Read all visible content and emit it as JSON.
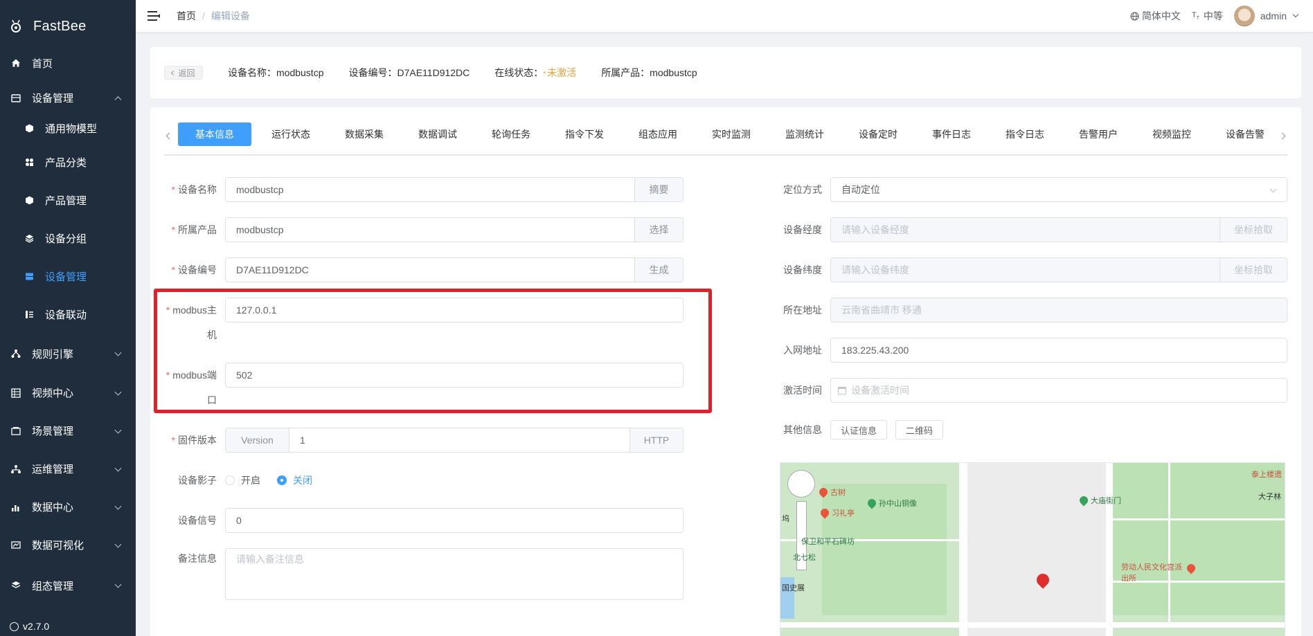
{
  "app": {
    "name": "FastBee",
    "version": "v2.7.0"
  },
  "sidebar": {
    "items": [
      {
        "label": "首页",
        "icon": "home-icon"
      },
      {
        "label": "设备管理",
        "icon": "device-icon",
        "expanded": true
      },
      {
        "label": "通用物模型",
        "icon": "cube-icon",
        "sub": true
      },
      {
        "label": "产品分类",
        "icon": "category-icon",
        "sub": true
      },
      {
        "label": "产品管理",
        "icon": "box-icon",
        "sub": true
      },
      {
        "label": "设备分组",
        "icon": "layers-icon",
        "sub": true
      },
      {
        "label": "设备管理",
        "icon": "device-list-icon",
        "sub": true,
        "active": true
      },
      {
        "label": "设备联动",
        "icon": "link-icon",
        "sub": true
      },
      {
        "label": "规则引擎",
        "icon": "rule-icon"
      },
      {
        "label": "视频中心",
        "icon": "video-icon"
      },
      {
        "label": "场景管理",
        "icon": "scene-icon"
      },
      {
        "label": "运维管理",
        "icon": "ops-icon"
      },
      {
        "label": "数据中心",
        "icon": "chart-icon"
      },
      {
        "label": "数据可视化",
        "icon": "visual-icon"
      },
      {
        "label": "组态管理",
        "icon": "config-icon"
      }
    ]
  },
  "navbar": {
    "breadcrumb": [
      "首页",
      "编辑设备"
    ],
    "separator": "/",
    "language": "简体中文",
    "size": "中等",
    "user": "admin"
  },
  "info": {
    "back": "返回",
    "device_name": "设备名称：modbustcp",
    "device_no": "设备编号：D7AE11D912DC",
    "status_label": "在线状态：",
    "status_value": "未激活",
    "product": "所属产品：modbustcp"
  },
  "tabs": [
    "基本信息",
    "运行状态",
    "数据采集",
    "数据调试",
    "轮询任务",
    "指令下发",
    "组态应用",
    "实时监测",
    "监测统计",
    "设备定时",
    "事件日志",
    "指令日志",
    "告警用户",
    "视频监控",
    "设备告警"
  ],
  "form_left": {
    "name": {
      "label": "设备名称",
      "value": "modbustcp",
      "append": "摘要"
    },
    "product": {
      "label": "所属产品",
      "value": "modbustcp",
      "append": "选择"
    },
    "serial": {
      "label": "设备编号",
      "value": "D7AE11D912DC",
      "append": "生成"
    },
    "host": {
      "label_a": "modbus主",
      "label_b": "机",
      "value": "127.0.0.1"
    },
    "port": {
      "label_a": "modbus端",
      "label_b": "口",
      "value": "502"
    },
    "firmware": {
      "label": "固件版本",
      "prepend": "Version",
      "value": "1",
      "append": "HTTP"
    },
    "shadow": {
      "label": "设备影子",
      "on": "开启",
      "off": "关闭",
      "selected": "关闭"
    },
    "signal": {
      "label": "设备信号",
      "value": "0"
    },
    "remark": {
      "label": "备注信息",
      "placeholder": "请输入备注信息"
    }
  },
  "form_right": {
    "location": {
      "label": "定位方式",
      "value": "自动定位"
    },
    "longitude": {
      "label": "设备经度",
      "placeholder": "请输入设备经度",
      "append": "坐标拾取"
    },
    "latitude": {
      "label": "设备纬度",
      "placeholder": "请输入设备纬度",
      "append": "坐标拾取"
    },
    "address": {
      "label": "所在地址",
      "value": "云南省曲靖市 移通"
    },
    "ip": {
      "label": "入网地址",
      "value": "183.225.43.200"
    },
    "activate": {
      "label": "激活时间",
      "placeholder": "设备激活时间"
    },
    "other": {
      "label": "其他信息",
      "btn1": "认证信息",
      "btn2": "二维码"
    }
  },
  "map": {
    "labels": [
      "古树",
      "孙中山铜像",
      "习礼亭",
      "保卫和平石碑坊",
      "北七松",
      "大庙街门",
      "劳动人民文化宫派出所",
      "泰上楼遗",
      "大子林",
      "坞",
      "国史展"
    ]
  },
  "colors": {
    "sidebar_bg": "#1f2d3d",
    "accent": "#409eff",
    "warning": "#e6a23c",
    "danger": "#f56c6c",
    "highlight_box": "#e0202a"
  }
}
